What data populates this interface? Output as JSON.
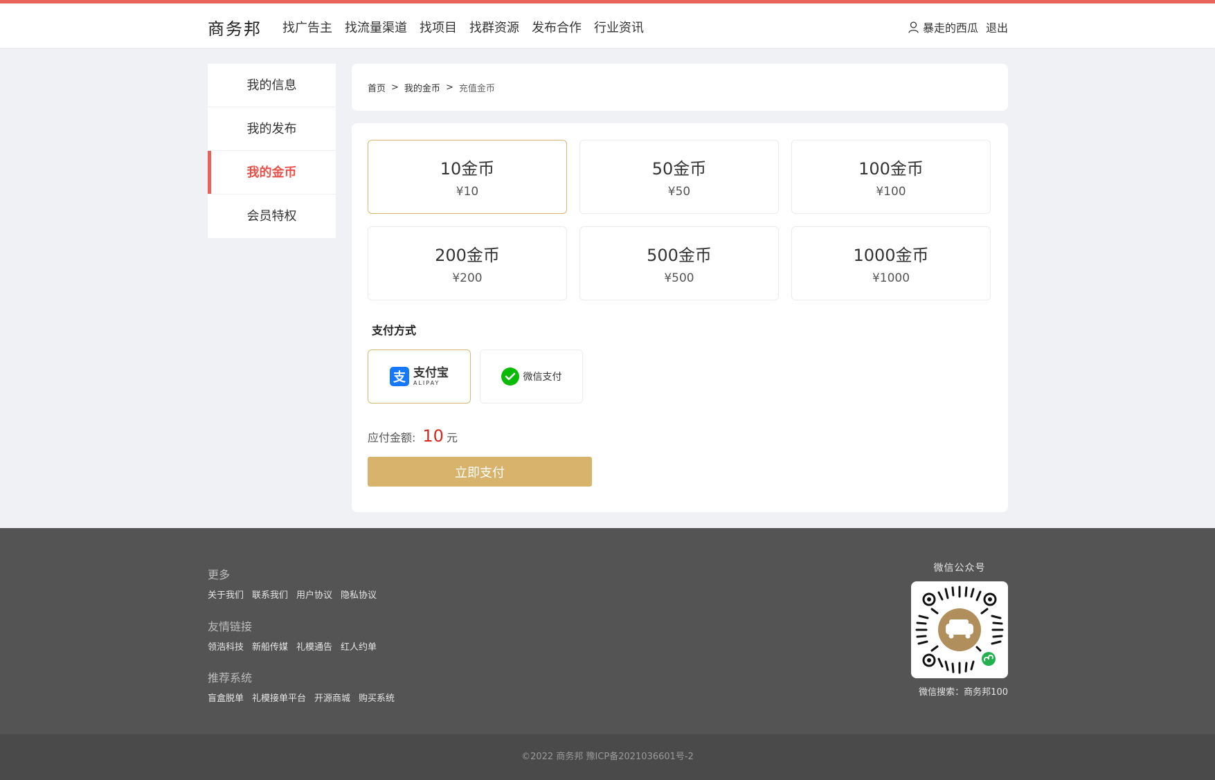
{
  "colors": {
    "accent_line": "#e8645a",
    "active_menu": "#e8524a",
    "gold": "#d8b36b",
    "price_red": "#d9261c",
    "footer_bg": "#545454"
  },
  "header": {
    "logo": "商务邦",
    "nav": [
      "找广告主",
      "找流量渠道",
      "找项目",
      "找群资源",
      "发布合作",
      "行业资讯"
    ],
    "user_icon": "user-icon",
    "username": "暴走的西瓜",
    "logout": "退出"
  },
  "sidebar": {
    "items": [
      {
        "label": "我的信息",
        "active": false
      },
      {
        "label": "我的发布",
        "active": false
      },
      {
        "label": "我的金币",
        "active": true
      },
      {
        "label": "会员特权",
        "active": false
      }
    ]
  },
  "breadcrumb": {
    "items": [
      "首页",
      "我的金币",
      "充值金币"
    ],
    "separator": ">"
  },
  "coins": {
    "options": [
      {
        "amount": "10金币",
        "price": "¥10",
        "selected": true
      },
      {
        "amount": "50金币",
        "price": "¥50",
        "selected": false
      },
      {
        "amount": "100金币",
        "price": "¥100",
        "selected": false
      },
      {
        "amount": "200金币",
        "price": "¥200",
        "selected": false
      },
      {
        "amount": "500金币",
        "price": "¥500",
        "selected": false
      },
      {
        "amount": "1000金币",
        "price": "¥1000",
        "selected": false
      }
    ]
  },
  "payment": {
    "title": "支付方式",
    "alipay": {
      "cn": "支付宝",
      "en": "ALIPAY",
      "logo_char": "支",
      "selected": true
    },
    "wechat": {
      "label": "微信支付",
      "selected": false
    },
    "amount_label": "应付金额:",
    "amount_value": "10",
    "amount_unit": "元",
    "pay_button": "立即支付"
  },
  "footer": {
    "more_title": "更多",
    "more_links": [
      "关于我们",
      "联系我们",
      "用户协议",
      "隐私协议"
    ],
    "friend_title": "友情链接",
    "friend_links": [
      "领浩科技",
      "新船传媒",
      "礼模通告",
      "红人约单"
    ],
    "recommend_title": "推荐系统",
    "recommend_links": [
      "盲盒脱单",
      "礼模接单平台",
      "开源商城",
      "购买系统"
    ],
    "wechat_title": "微信公众号",
    "wechat_search": "微信搜索：商务邦100",
    "copyright": "©2022 商务邦 豫ICP备2021036601号-2"
  }
}
